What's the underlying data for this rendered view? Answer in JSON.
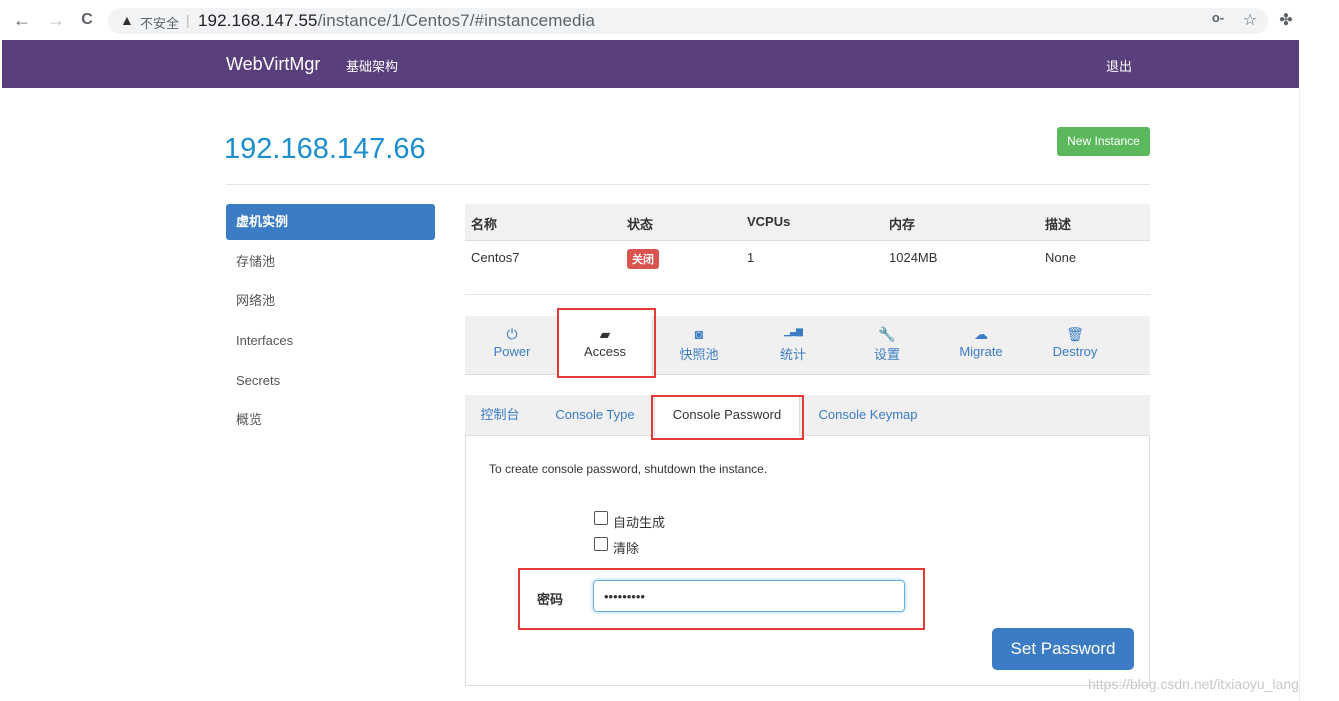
{
  "browser": {
    "back_icon": "←",
    "forward_icon": "→",
    "reload_icon": "C",
    "security_icon": "▲",
    "security_text": "不安全",
    "separator": "|",
    "url_host": "192.168.147.55",
    "url_path": "/instance/1/Centos7/#instancemedia",
    "key_icon": "o-",
    "star_icon": "☆",
    "extensions_icon": "✤"
  },
  "navbar": {
    "brand": "WebVirtMgr",
    "infrastructure": "基础架构",
    "logout": "退出"
  },
  "header": {
    "host": "192.168.147.66",
    "new_instance": "New Instance"
  },
  "sidebar": {
    "items": [
      {
        "label": "虚机实例",
        "active": true
      },
      {
        "label": "存储池"
      },
      {
        "label": "网络池"
      },
      {
        "label": "Interfaces"
      },
      {
        "label": "Secrets"
      },
      {
        "label": "概览"
      }
    ]
  },
  "instance_table": {
    "headers": [
      "名称",
      "状态",
      "VCPUs",
      "内存",
      "描述"
    ],
    "row": {
      "name": "Centos7",
      "status": "关闭",
      "vcpus": "1",
      "memory": "1024MB",
      "description": "None"
    }
  },
  "action_tabs": [
    {
      "label": "Power",
      "icon": "⏻"
    },
    {
      "label": "Access",
      "icon": "▰",
      "active": true
    },
    {
      "label": "快照池",
      "icon": "◙"
    },
    {
      "label": "统计",
      "icon": "▁▃▆"
    },
    {
      "label": "设置",
      "icon": "🔧"
    },
    {
      "label": "Migrate",
      "icon": "☁"
    },
    {
      "label": "Destroy",
      "icon": "🗑"
    }
  ],
  "console_tabs": [
    {
      "label": "控制台"
    },
    {
      "label": "Console Type"
    },
    {
      "label": "Console Password",
      "active": true
    },
    {
      "label": "Console Keymap"
    }
  ],
  "console_password": {
    "help": "To create console password, shutdown the instance.",
    "auto_generate": "自动生成",
    "clear": "清除",
    "password_label": "密码",
    "password_value": "•••••••••",
    "submit": "Set Password"
  },
  "watermark": "https://blog.csdn.net/itxiaoyu_lang",
  "colors": {
    "navbar": "#593f7c",
    "link": "#3b7cc5",
    "success": "#5cb85c",
    "danger": "#d9534f",
    "highlight_box": "#e53935"
  }
}
